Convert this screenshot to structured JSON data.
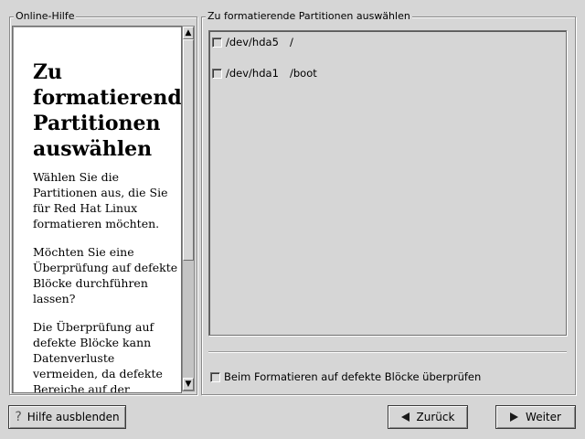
{
  "help_panel": {
    "title": "Online-Hilfe",
    "heading": "Zu formatierende Partitionen auswählen",
    "paragraphs": [
      "Wählen Sie die Partitionen aus, die Sie für Red Hat Linux formatieren möchten.",
      "Möchten Sie eine Überprüfung auf defekte Blöcke durchführen lassen?",
      "Die Überprüfung auf defekte Blöcke kann Datenverluste vermeiden, da defekte Bereiche auf der"
    ],
    "scroll_up_glyph": "▲",
    "scroll_down_glyph": "▼"
  },
  "partition_panel": {
    "title": "Zu formatierende Partitionen auswählen",
    "partitions": [
      {
        "device": "/dev/hda5",
        "mount": "/",
        "checked": false
      },
      {
        "device": "/dev/hda1",
        "mount": "/boot",
        "checked": false
      }
    ],
    "badblocks_label": "Beim Formatieren auf defekte Blöcke überprüfen",
    "badblocks_checked": false
  },
  "buttons": {
    "hide_help": "Hilfe ausblenden",
    "hide_help_icon": "?",
    "back": "Zurück",
    "next": "Weiter"
  },
  "icons": {
    "hide_help": "question-icon",
    "back": "left-arrow-icon",
    "next": "right-arrow-icon"
  }
}
